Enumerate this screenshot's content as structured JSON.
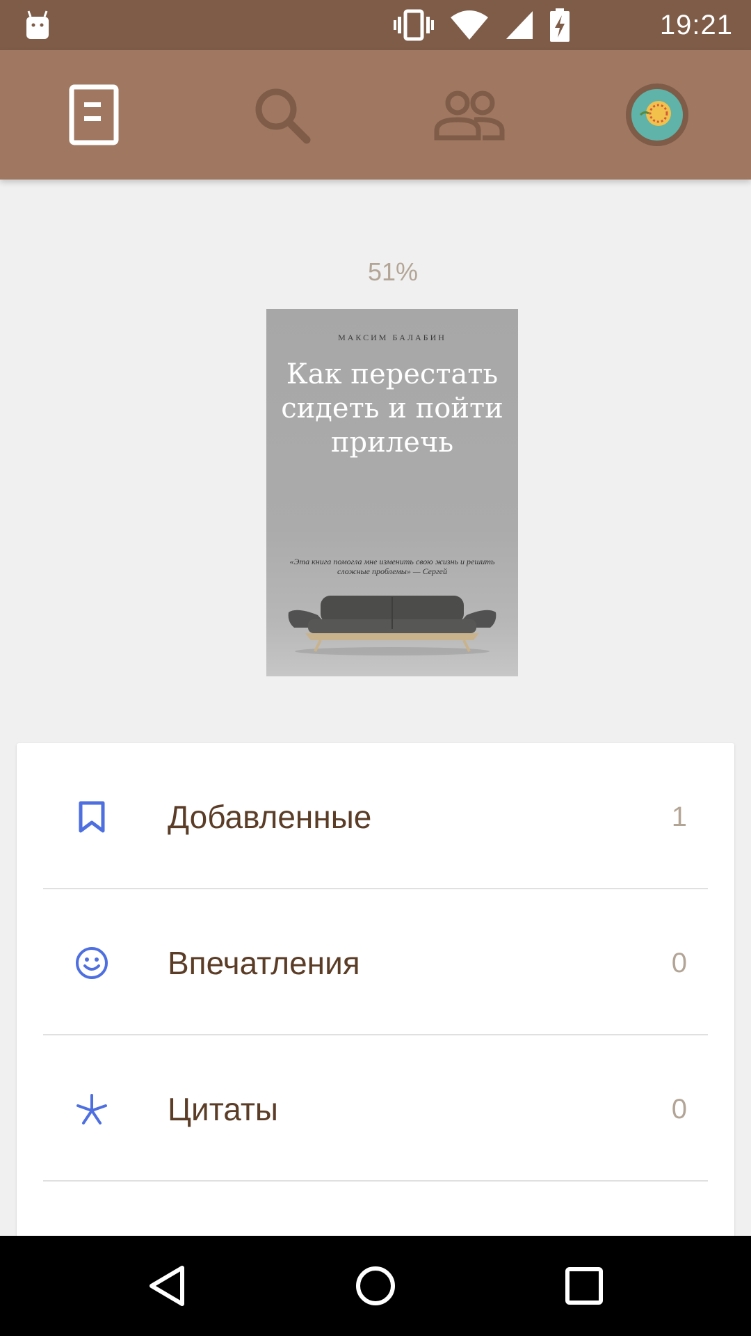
{
  "status_bar": {
    "time": "19:21",
    "icons": [
      "android-icon",
      "vibrate-icon",
      "wifi-icon",
      "signal-icon",
      "battery-charging-icon"
    ],
    "background": "#7e5c48"
  },
  "toolbar": {
    "background": "#a07760",
    "tabs": [
      {
        "name": "library-tab",
        "icon": "book-icon",
        "active": true
      },
      {
        "name": "search-tab",
        "icon": "search-icon",
        "active": false
      },
      {
        "name": "people-tab",
        "icon": "people-icon",
        "active": false
      },
      {
        "name": "profile-tab",
        "icon": "avatar-icon",
        "active": false
      }
    ]
  },
  "book": {
    "progress_label": "51%",
    "progress": 0.51,
    "cover": {
      "author": "МАКСИМ БАЛАБИН",
      "title": "Как перестать сидеть и пойти прилечь",
      "quote": "«Эта книга помогла мне изменить свою жизнь и решить сложные проблемы» — Сергей"
    }
  },
  "list": {
    "items": [
      {
        "label": "Добавленные",
        "count": "1",
        "icon": "bookmark-icon"
      },
      {
        "label": "Впечатления",
        "count": "0",
        "icon": "smile-icon"
      },
      {
        "label": "Цитаты",
        "count": "0",
        "icon": "asterisk-icon"
      }
    ],
    "accent": "#4e6fe0"
  },
  "nav_bar": {
    "buttons": [
      "back-icon",
      "home-icon",
      "recents-icon"
    ]
  }
}
